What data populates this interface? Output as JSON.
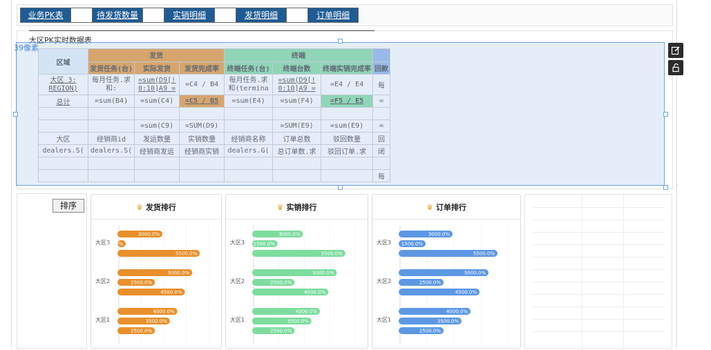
{
  "tabs": [
    {
      "label": "业务PK表"
    },
    {
      "label": "待发货数量"
    },
    {
      "label": "实销明细"
    },
    {
      "label": "发货明细"
    },
    {
      "label": "订单明细"
    }
  ],
  "report": {
    "title": "大区PK实时数据表",
    "size_label": "39像素"
  },
  "table": {
    "header": {
      "region": "区域",
      "group_delivery": "发货",
      "group_terminal": "终端",
      "col_delivery_task": "发货任务(台)",
      "col_actual_delivery": "实际发货",
      "col_delivery_rate": "发货完成率",
      "col_terminal_task": "终端任务(台)",
      "col_terminal_count": "终端台数",
      "col_terminal_rate": "终端实销完成率",
      "col_payment": "回款"
    },
    "row_region": [
      "大区 3:\nREGION)",
      "每月任务.求\n和:",
      "=sum(D9[!\n0:10]A9 =",
      "=C4 / B4",
      "每月任务.求\n和(termina",
      "=sum(D9[!\n0:10]A9 =",
      "=E4 / E4",
      "每"
    ],
    "row_total": [
      "总计",
      "=sum(B4)",
      "=sum(C4)",
      "=C5 / B5",
      "=sum(E4)",
      "=sum(F4)",
      "=F5 / E5",
      "="
    ],
    "row_sum": [
      "",
      "",
      "=sum(C9)",
      "=SUM(D9)",
      "",
      "=SUM(E9)",
      "=sum(E9)",
      "="
    ],
    "row_labels": [
      "大区",
      "经销商id",
      "发运数量",
      "实销数量",
      "经销商名称",
      "订单总数",
      "驳回数量",
      "回"
    ],
    "row_fields": [
      "dealers.S(",
      "dealers.S(",
      "经销商发运",
      "经销商实销",
      "dealers.G(",
      "总订单数.求",
      "驳回订单.求",
      "闭"
    ],
    "row_last": [
      "每"
    ]
  },
  "bottom": {
    "sort_label": "排序"
  },
  "charts": [
    {
      "title": "发货排行",
      "color": "#e8902c",
      "chart_data": {
        "type": "bar",
        "categories": [
          "大区3",
          "大区2",
          "大区1"
        ],
        "series": [
          {
            "values": [
              3000.0,
              500.0,
              5500.0
            ]
          },
          {
            "values": [
              5000.0,
              2500.0,
              4500.0
            ]
          },
          {
            "values": [
              4000.0,
              3500.0,
              2500.0
            ]
          }
        ],
        "labels": [
          [
            "3000.0%",
            "500.0%",
            "5500.0%"
          ],
          [
            "5000.0%",
            "2500.0%",
            "4500.0%"
          ],
          [
            "4000.0%",
            "3500.0%",
            "2500.0%"
          ]
        ],
        "xlim": [
          0,
          6000
        ]
      }
    },
    {
      "title": "实销排行",
      "color": "#7ddc9e",
      "chart_data": {
        "type": "bar",
        "categories": [
          "大区3",
          "大区2",
          "大区1"
        ],
        "series": [
          {
            "values": [
              3000.0,
              1500.0,
              5500.0
            ]
          },
          {
            "values": [
              5000.0,
              2500.0,
              4500.0
            ]
          },
          {
            "values": [
              4000.0,
              3500.0,
              2500.0
            ]
          }
        ],
        "labels": [
          [
            "3000.0%",
            "1500.0%",
            "5500.0%"
          ],
          [
            "5000.0%",
            "2500.0%",
            "4500.0%"
          ],
          [
            "4000.0%",
            "3500.0%",
            "2500.0%"
          ]
        ],
        "xlim": [
          0,
          6000
        ]
      }
    },
    {
      "title": "订单排行",
      "color": "#5d98e4",
      "chart_data": {
        "type": "bar",
        "categories": [
          "大区3",
          "大区2",
          "大区1"
        ],
        "series": [
          {
            "values": [
              3000.0,
              1500.0,
              5500.0
            ]
          },
          {
            "values": [
              5000.0,
              2500.0,
              4500.0
            ]
          },
          {
            "values": [
              4000.0,
              3500.0,
              2500.0
            ]
          }
        ],
        "labels": [
          [
            "3000.0%",
            "1500.0%",
            "5500.0%"
          ],
          [
            "5000.0%",
            "2500.0%",
            "4500.0%"
          ],
          [
            "4000.0%",
            "3500.0%",
            "2500.0%"
          ]
        ],
        "xlim": [
          0,
          6000
        ]
      }
    }
  ]
}
